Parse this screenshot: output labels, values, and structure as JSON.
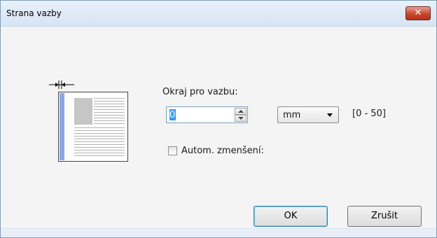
{
  "window": {
    "title": "Strana vazby",
    "close_glyph": "✕"
  },
  "form": {
    "margin_label": "Okraj pro vazbu:",
    "margin_value": "0",
    "unit_selected": "mm",
    "range_text": "[0 - 50]",
    "auto_reduce_label": "Autom. zmenšení:",
    "auto_reduce_checked": false
  },
  "buttons": {
    "ok_label": "OK",
    "cancel_label": "Zrušit"
  },
  "icons": {
    "illustration": "binding-margin-page-icon",
    "marker": "margin-marker-icon"
  },
  "colors": {
    "binding_strip": "#8aa8e8",
    "close_button": "#c7472f",
    "selection": "#3399ff"
  }
}
